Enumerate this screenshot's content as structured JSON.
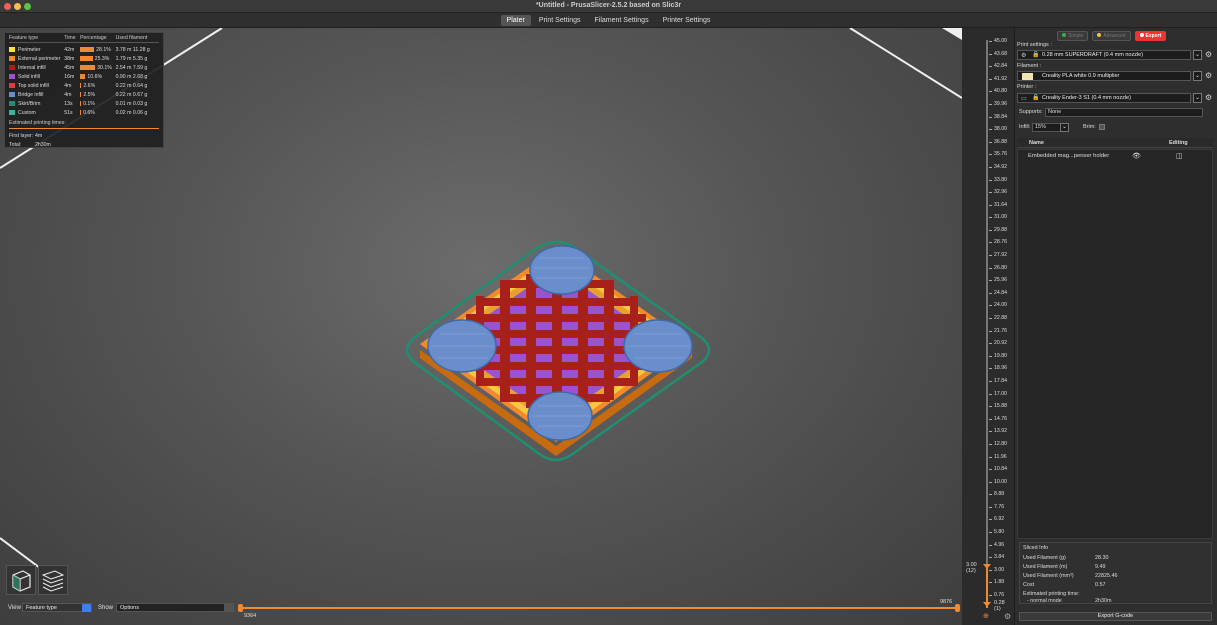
{
  "window": {
    "title": "*Untitled - PrusaSlicer-2.5.2 based on Slic3r"
  },
  "tabs": [
    {
      "label": "Plater"
    },
    {
      "label": "Print Settings"
    },
    {
      "label": "Filament Settings"
    },
    {
      "label": "Printer Settings"
    }
  ],
  "legend": {
    "headers": {
      "feature": "Feature type",
      "time": "Time",
      "pct": "Percentage",
      "used": "Used filament"
    },
    "rows": [
      {
        "feature": "Perimeter",
        "color": "#f7e33b",
        "time": "42m",
        "pct": "28.1%",
        "pct_value": 28.1,
        "used": "3.78 m  11.28 g"
      },
      {
        "feature": "External perimeter",
        "color": "#f08a2c",
        "time": "38m",
        "pct": "25.3%",
        "pct_value": 25.3,
        "used": "1.79 m  5.35 g"
      },
      {
        "feature": "Internal infill",
        "color": "#a8201a",
        "time": "45m",
        "pct": "30.1%",
        "pct_value": 30.1,
        "used": "2.54 m  7.59 g"
      },
      {
        "feature": "Solid infill",
        "color": "#9a52cf",
        "time": "16m",
        "pct": "10.6%",
        "pct_value": 10.6,
        "used": "0.90 m  2.68 g"
      },
      {
        "feature": "Top solid infill",
        "color": "#e4383b",
        "time": "4m",
        "pct": "2.6%",
        "pct_value": 2.6,
        "used": "0.22 m  0.64 g"
      },
      {
        "feature": "Bridge infill",
        "color": "#6a8ecb",
        "time": "4m",
        "pct": "2.5%",
        "pct_value": 2.5,
        "used": "0.22 m  0.67 g"
      },
      {
        "feature": "Skirt/Brim",
        "color": "#1e8f71",
        "time": "13s",
        "pct": "0.1%",
        "pct_value": 0.1,
        "used": "0.01 m  0.03 g"
      },
      {
        "feature": "Custom",
        "color": "#43b09c",
        "time": "51s",
        "pct": "0.6%",
        "pct_value": 0.6,
        "used": "0.02 m  0.06 g"
      }
    ],
    "estimated_title": "Estimated printing times:",
    "first_layer_label": "First layer:",
    "first_layer_value": "4m",
    "total_label": "Total:",
    "total_value": "2h30m"
  },
  "bottom": {
    "view_label": "View",
    "view_value": "Feature type",
    "show_label": "Show",
    "show_value": "Options",
    "h_slider_min": "9364",
    "h_slider_max": "9876"
  },
  "vertical_slider": {
    "ticks": [
      "45.00",
      "43.68",
      "42.84",
      "41.92",
      "40.80",
      "39.96",
      "38.84",
      "38.00",
      "36.88",
      "35.76",
      "34.92",
      "33.80",
      "32.96",
      "31.64",
      "31.00",
      "29.88",
      "28.76",
      "27.92",
      "26.80",
      "25.96",
      "24.84",
      "24.00",
      "22.88",
      "21.76",
      "20.92",
      "19.80",
      "18.96",
      "17.84",
      "17.00",
      "15.88",
      "14.76",
      "13.92",
      "12.80",
      "11.96",
      "10.84",
      "10.00",
      "8.88",
      "7.76",
      "6.92",
      "5.80",
      "4.96",
      "3.84",
      "3.00",
      "1.88",
      "0.76"
    ],
    "current_top": "3.00",
    "current_top_index": "(12)",
    "current_bottom": "0.28",
    "current_bottom_index": "(1)"
  },
  "sidebar": {
    "modes": [
      {
        "label": "Simple",
        "dot": "#3cb043"
      },
      {
        "label": "Advanced",
        "dot": "#f4bd4f"
      },
      {
        "label": "Expert",
        "dot": "#ffffff"
      }
    ],
    "print_settings_label": "Print settings :",
    "print_settings_value": "0.28 mm SUPERDRAFT (0.4 mm nozzle)",
    "filament_label": "Filament :",
    "filament_value": "Creality PLA white 0.9 multiplier",
    "printer_label": "Printer :",
    "printer_value": "Creality Ender-3 S1 (0.4 mm nozzle)",
    "supports_label": "Supports:",
    "supports_value": "None",
    "infill_label": "Infill:",
    "infill_value": "15%",
    "brim_label": "Brim:",
    "objects_header_name": "Name",
    "objects_header_editing": "Editing",
    "object_name": "Embedded mag...penser holder",
    "sliced_info_title": "Sliced Info",
    "sliced_info": [
      {
        "label": "Used Filament (g)",
        "value": "28.30"
      },
      {
        "label": "Used Filament (m)",
        "value": "9.49"
      },
      {
        "label": "Used Filament (mm³)",
        "value": "22825.46"
      },
      {
        "label": "Cost",
        "value": "0.57"
      },
      {
        "label": "Estimated printing time:",
        "value": ""
      },
      {
        "label": "- normal mode",
        "value": "2h30m"
      }
    ],
    "export_label": "Export G-code"
  }
}
